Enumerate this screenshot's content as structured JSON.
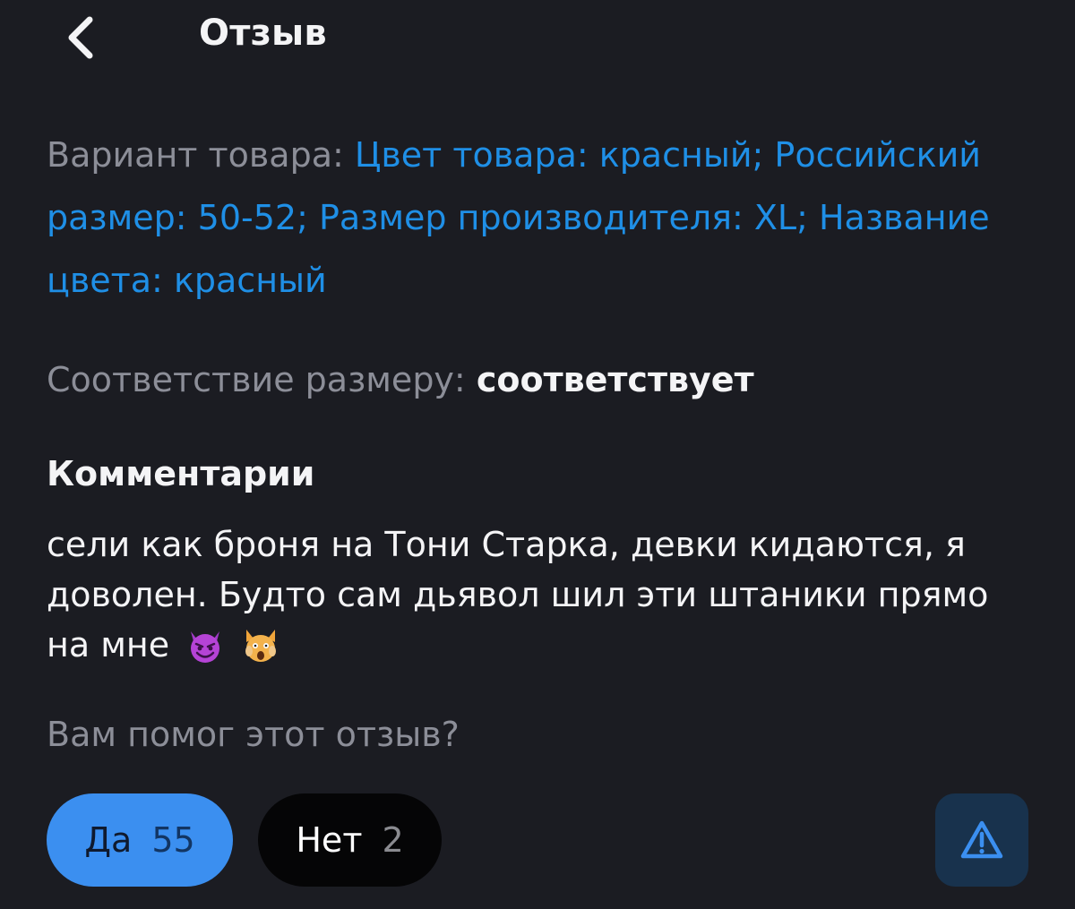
{
  "header": {
    "title": "Отзыв",
    "back_icon": "chevron-left-icon"
  },
  "variant": {
    "label": "Вариант товара:",
    "value": "Цвет товара: красный; Российский размер: 50-52; Размер производителя: XL; Название цвета: красный"
  },
  "size_match": {
    "label": "Соответствие размеру:",
    "value": "соответствует"
  },
  "comments": {
    "title": "Комментарии",
    "text": "сели как броня на Тони Старка, девки кидаются, я доволен. Будто сам дьявол шил эти штаники прямо на мне",
    "emojis": [
      "smiling-devil-emoji",
      "weary-cat-emoji"
    ]
  },
  "helpful": {
    "question": "Вам помог этот отзыв?",
    "yes_label": "Да",
    "yes_count": "55",
    "no_label": "Нет",
    "no_count": "2",
    "report_icon": "warning-triangle-icon"
  },
  "colors": {
    "background": "#1b1c22",
    "accent": "#1f8fe6",
    "yes_button": "#3b8ff0",
    "no_button": "#050506",
    "report_button": "#18324d"
  }
}
